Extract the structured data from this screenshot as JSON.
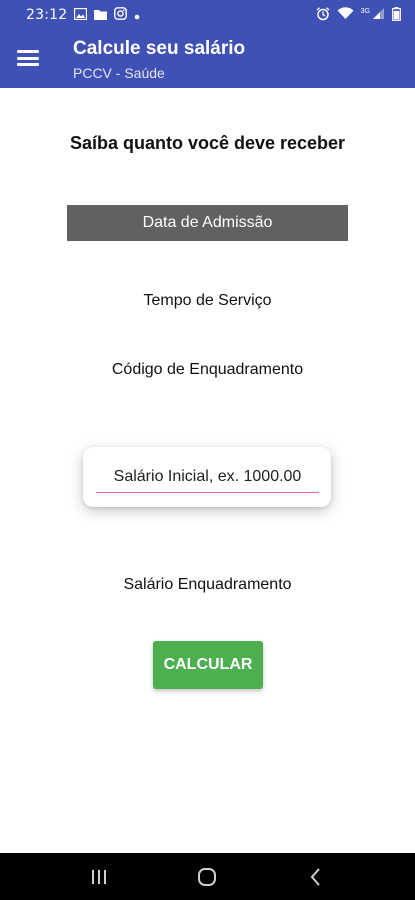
{
  "status_bar": {
    "time": "23:12",
    "left_icons": [
      "gallery-icon",
      "folder-icon",
      "instagram-icon",
      "dot-icon"
    ],
    "right_icons": [
      "alarm-icon",
      "wifi-icon",
      "cell-signal-icon",
      "battery-icon"
    ],
    "network_label": "3G"
  },
  "app_bar": {
    "title": "Calcule seu salário",
    "subtitle": "PCCV - Saúde",
    "background": "#3f51b5"
  },
  "main": {
    "heading": "Saíba quanto você deve receber",
    "admission_button": "Data de Admissão",
    "service_time_label": "Tempo de Serviço",
    "framework_code_label": "Código de Enquadramento",
    "initial_salary_placeholder": "Salário Inicial, ex. 1000.00",
    "framework_salary_label": "Salário Enquadramento",
    "calculate_button": "CALCULAR",
    "calculate_color": "#4caf50"
  }
}
